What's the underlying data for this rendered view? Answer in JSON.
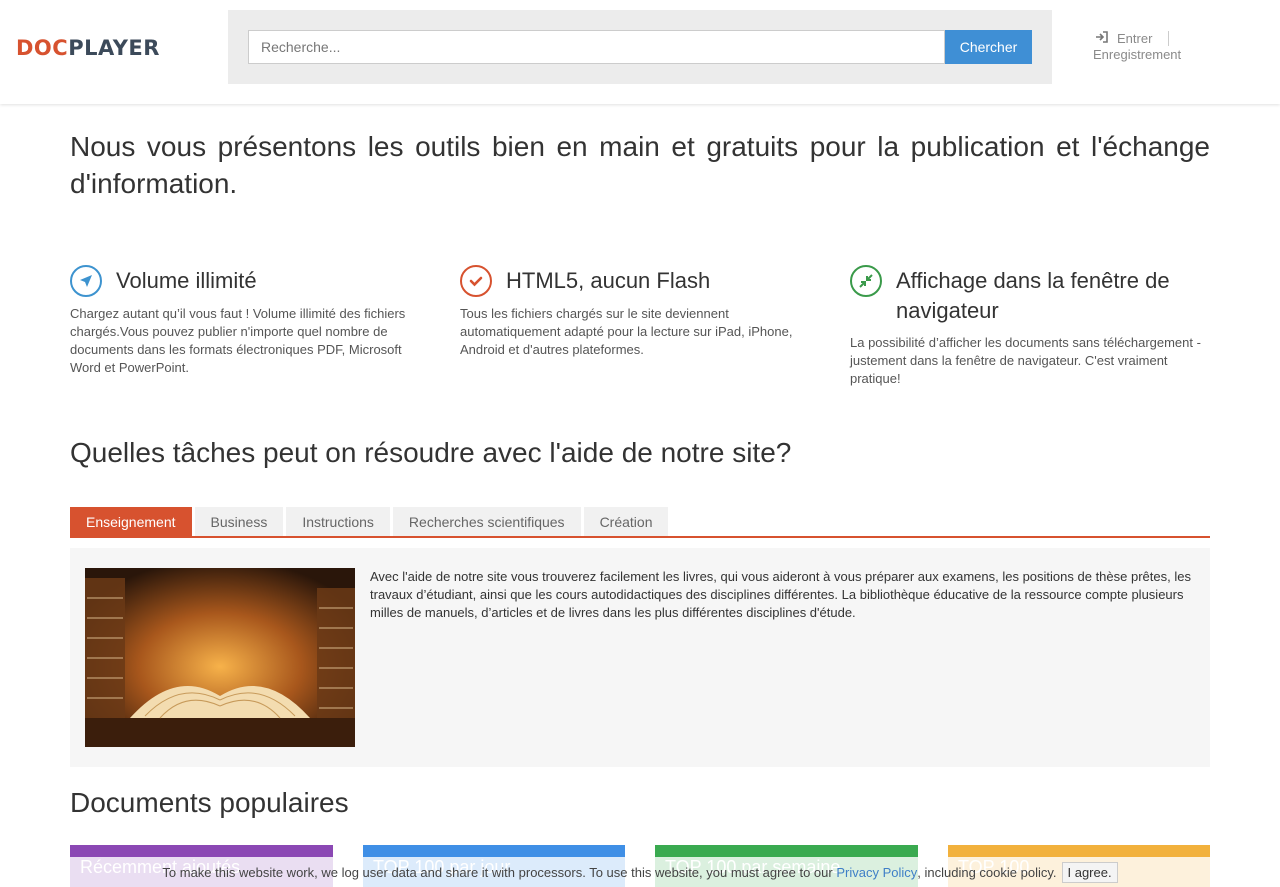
{
  "header": {
    "logo_part1": "DOC",
    "logo_part2": "PLAYER",
    "search_placeholder": "Recherche...",
    "search_button": "Chercher",
    "login": "Entrer",
    "register": "Enregistrement"
  },
  "intro": "Nous vous présentons les outils bien en main et gratuits pour la publication et l'échange d'information.",
  "features": [
    {
      "title": "Volume illimité",
      "text": "Chargez autant qu’il vous faut ! Volume illimité des fichiers chargés.Vous pouvez publier n'importe quel nombre de documents dans les formats électroniques PDF, Microsoft Word et PowerPoint.",
      "icon": "navigation-arrow-icon"
    },
    {
      "title": "HTML5, aucun Flash",
      "text": "Tous les fichiers chargés sur le site deviennent automatiquement adapté pour la lecture sur iPad, iPhone, Android et d'autres plateformes.",
      "icon": "checkmark-icon"
    },
    {
      "title": "Affichage dans la fenêtre de navigateur",
      "text": "La possibilité d’afficher les documents sans téléchargement - justement dans la fenêtre de navigateur. C'est vraiment pratique!",
      "icon": "compress-arrows-icon"
    }
  ],
  "tasks": {
    "title": "Quelles tâches peut on résoudre avec l'aide de notre site?",
    "tabs": [
      "Enseignement",
      "Business",
      "Instructions",
      "Recherches scientifiques",
      "Création"
    ],
    "active_tab": "Enseignement",
    "panel_text": "Avec l'aide de notre site vous trouverez facilement les livres, qui vous aideront à vous préparer aux examens, les positions de thèse prêtes, les travaux d’étudiant, ainsi que les cours autodidactiques des disciplines différentes. La bibliothèque éducative de la ressource compte plusieurs milles de manuels, d’articles et de livres dans les plus différentes disciplines d'étude."
  },
  "popular": {
    "title": "Documents populaires",
    "cards": [
      "Récemment ajoutés",
      "TOP 100 par jour",
      "TOP 100 par semaine",
      "TOP 100"
    ]
  },
  "cookie": {
    "text": "To make this website work, we log user data and share it with processors. To use this website, you must agree to our",
    "link": "Privacy Policy",
    "suffix": ", including cookie policy.",
    "button": "I agree."
  },
  "colors": {
    "accent": "#d7522f",
    "primary_button": "#3f8fd5",
    "card_purple": "#8b48b4",
    "card_blue": "#3f8fe6",
    "card_green": "#3aaa50",
    "card_orange": "#f2b13c"
  }
}
